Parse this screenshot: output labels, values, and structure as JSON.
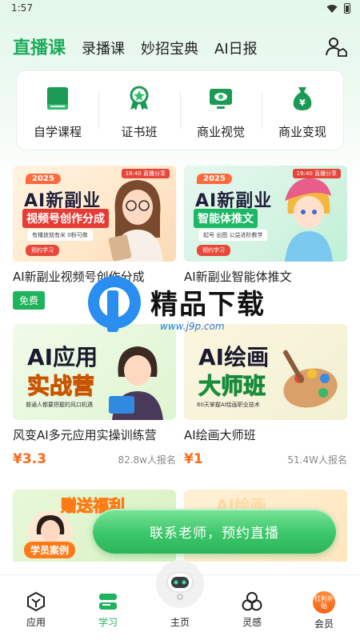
{
  "status_bar": {
    "time": "1:57"
  },
  "top_tabs": [
    {
      "label": "直播课",
      "active": true
    },
    {
      "label": "录播课",
      "active": false
    },
    {
      "label": "妙招宝典",
      "active": false
    },
    {
      "label": "AI日报",
      "active": false
    }
  ],
  "categories": [
    {
      "label": "自学课程",
      "icon": "book-icon"
    },
    {
      "label": "证书班",
      "icon": "award-icon"
    },
    {
      "label": "商业视觉",
      "icon": "monitor-eye-icon"
    },
    {
      "label": "商业变现",
      "icon": "money-bag-icon"
    }
  ],
  "courses": [
    {
      "title": "AI新副业视频号创作分成",
      "thumb": {
        "year": "2025",
        "line1": "AI新副业",
        "line2": "视频号创作分成",
        "tags": "有播放就有米  0粉可做",
        "btn": "预约学习",
        "corner": "18:40 直播分享"
      },
      "tag": "免费"
    },
    {
      "title": "AI新副业智能体推文",
      "thumb": {
        "year": "2025",
        "line1": "AI新副业",
        "line2": "智能体推文",
        "tags": "起号  出图  公益进阶教学",
        "btn": "预约学习",
        "corner": "19:40 直播分享"
      }
    },
    {
      "title": "风变AI多元应用实操训练营",
      "thumb": {
        "big1": "AI应用",
        "big2": "实战营",
        "sub": "普通人都要把握的风口机遇"
      },
      "price": "¥3.3",
      "signups": "82.8w人报名"
    },
    {
      "title": "AI绘画大师班",
      "thumb": {
        "big1": "AI绘画",
        "big2": "大师班",
        "sub": "60天掌握AI绘画职业技术"
      },
      "price": "¥1",
      "signups": "51.4W人报名"
    }
  ],
  "promo": {
    "left_text": "赠送福利",
    "right_text": "AI绘画",
    "case_label": "学员案例"
  },
  "cta": {
    "label": "联系老师，预约直播"
  },
  "watermark": {
    "brand": "精品下载",
    "url": "www.j9p.com"
  },
  "bottom_nav": [
    {
      "label": "应用",
      "icon": "hexagon-cube-icon",
      "active": false
    },
    {
      "label": "学习",
      "icon": "study-stack-icon",
      "active": true
    },
    {
      "label": "主页",
      "icon": "robot-icon",
      "active": false
    },
    {
      "label": "灵感",
      "icon": "circles-icon",
      "active": false
    },
    {
      "label": "会员",
      "icon": "vip-badge-icon",
      "active": false,
      "badge_text": "红利补贴"
    }
  ],
  "colors": {
    "accent": "#1fb35c",
    "price": "#ff6a1a",
    "watermark_blue": "#2a8ef0"
  }
}
